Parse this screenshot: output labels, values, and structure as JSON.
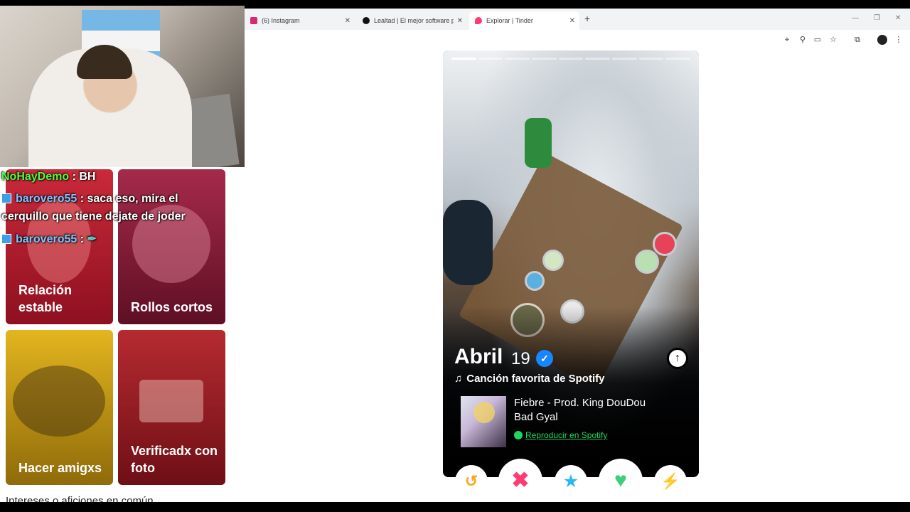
{
  "tabs": [
    {
      "label": "(6) Instagram",
      "icon": "instagram-icon",
      "color": "#d62976"
    },
    {
      "label": "Lealtad | El mejor software para",
      "icon": "lealtad-icon",
      "color": "#111111"
    },
    {
      "label": "Explorar | Tinder",
      "icon": "tinder-icon",
      "color": "#fe3c72"
    }
  ],
  "window_controls": {
    "minimize": "—",
    "restore": "❐",
    "close": "✕"
  },
  "toolbar_icons": [
    "location-icon",
    "zoom-icon",
    "cast-icon",
    "bookmark-star-icon",
    "extensions-icon",
    "profile-avatar-icon",
    "menu-kebab-icon"
  ],
  "explore": {
    "cards": [
      {
        "title": "Relación estable"
      },
      {
        "title": "Rollos cortos"
      },
      {
        "title": "Hacer amigxs"
      },
      {
        "title": "Verificadx con foto"
      }
    ],
    "section_title": "Intereses o aficiones en común"
  },
  "chat": [
    {
      "user": "NoHayDemo",
      "text": " : BH"
    },
    {
      "user": "barovero55",
      "text": " : saca eso, mira el"
    },
    {
      "user": "",
      "text": "cerquillo que tiene dejate de joder"
    },
    {
      "user": "barovero55",
      "text": " : "
    }
  ],
  "profile": {
    "name": "Abril",
    "age": "19",
    "verified": true,
    "spotify_heading": "Canción favorita de Spotify",
    "song_title": "Fiebre - Prod. King DouDou",
    "artist": "Bad Gyal",
    "play_label": "Reproducir en Spotify",
    "photo_count": 9,
    "current_photo": 1
  },
  "actions": [
    {
      "name": "rewind-button",
      "glyph": "↺",
      "color": "#f5a623"
    },
    {
      "name": "nope-button",
      "glyph": "✖",
      "color": "#fe3c72"
    },
    {
      "name": "super-like-button",
      "glyph": "★",
      "color": "#2ab5f6"
    },
    {
      "name": "like-button",
      "glyph": "♥",
      "color": "#3ad17a"
    },
    {
      "name": "boost-button",
      "glyph": "⚡",
      "color": "#b43cfa"
    }
  ]
}
